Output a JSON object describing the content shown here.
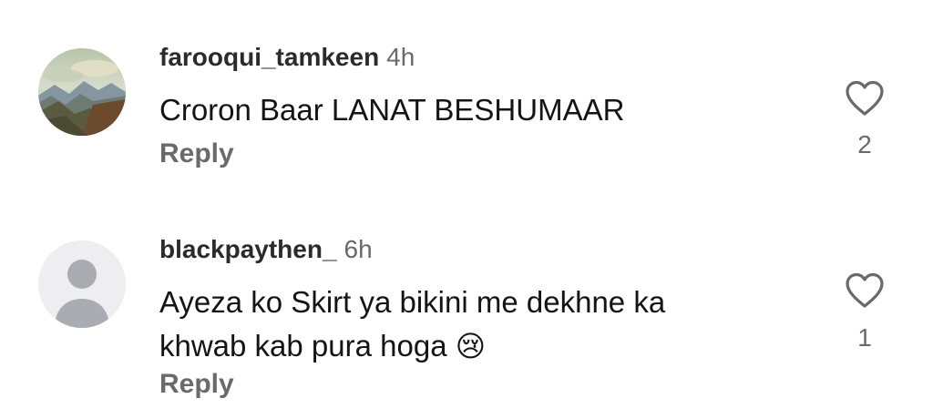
{
  "comments": [
    {
      "username": "farooqui_tamkeen",
      "time": "4h",
      "text": "Croron Baar LANAT BESHUMAAR",
      "reply_label": "Reply",
      "like_count": "2"
    },
    {
      "username": "blackpaythen_",
      "time": "6h",
      "text_line1": "Ayeza ko Skirt ya bikini me dekhne ka",
      "text_line2": "khwab kab pura hoga",
      "emoji": "😢",
      "reply_label": "Reply",
      "like_count": "1"
    }
  ],
  "colors": {
    "username": "#2b2b2b",
    "secondary": "#6a6a6a",
    "text": "#141414",
    "default_avatar_bg": "#eeeef0",
    "default_avatar_fg": "#a9acb1"
  }
}
